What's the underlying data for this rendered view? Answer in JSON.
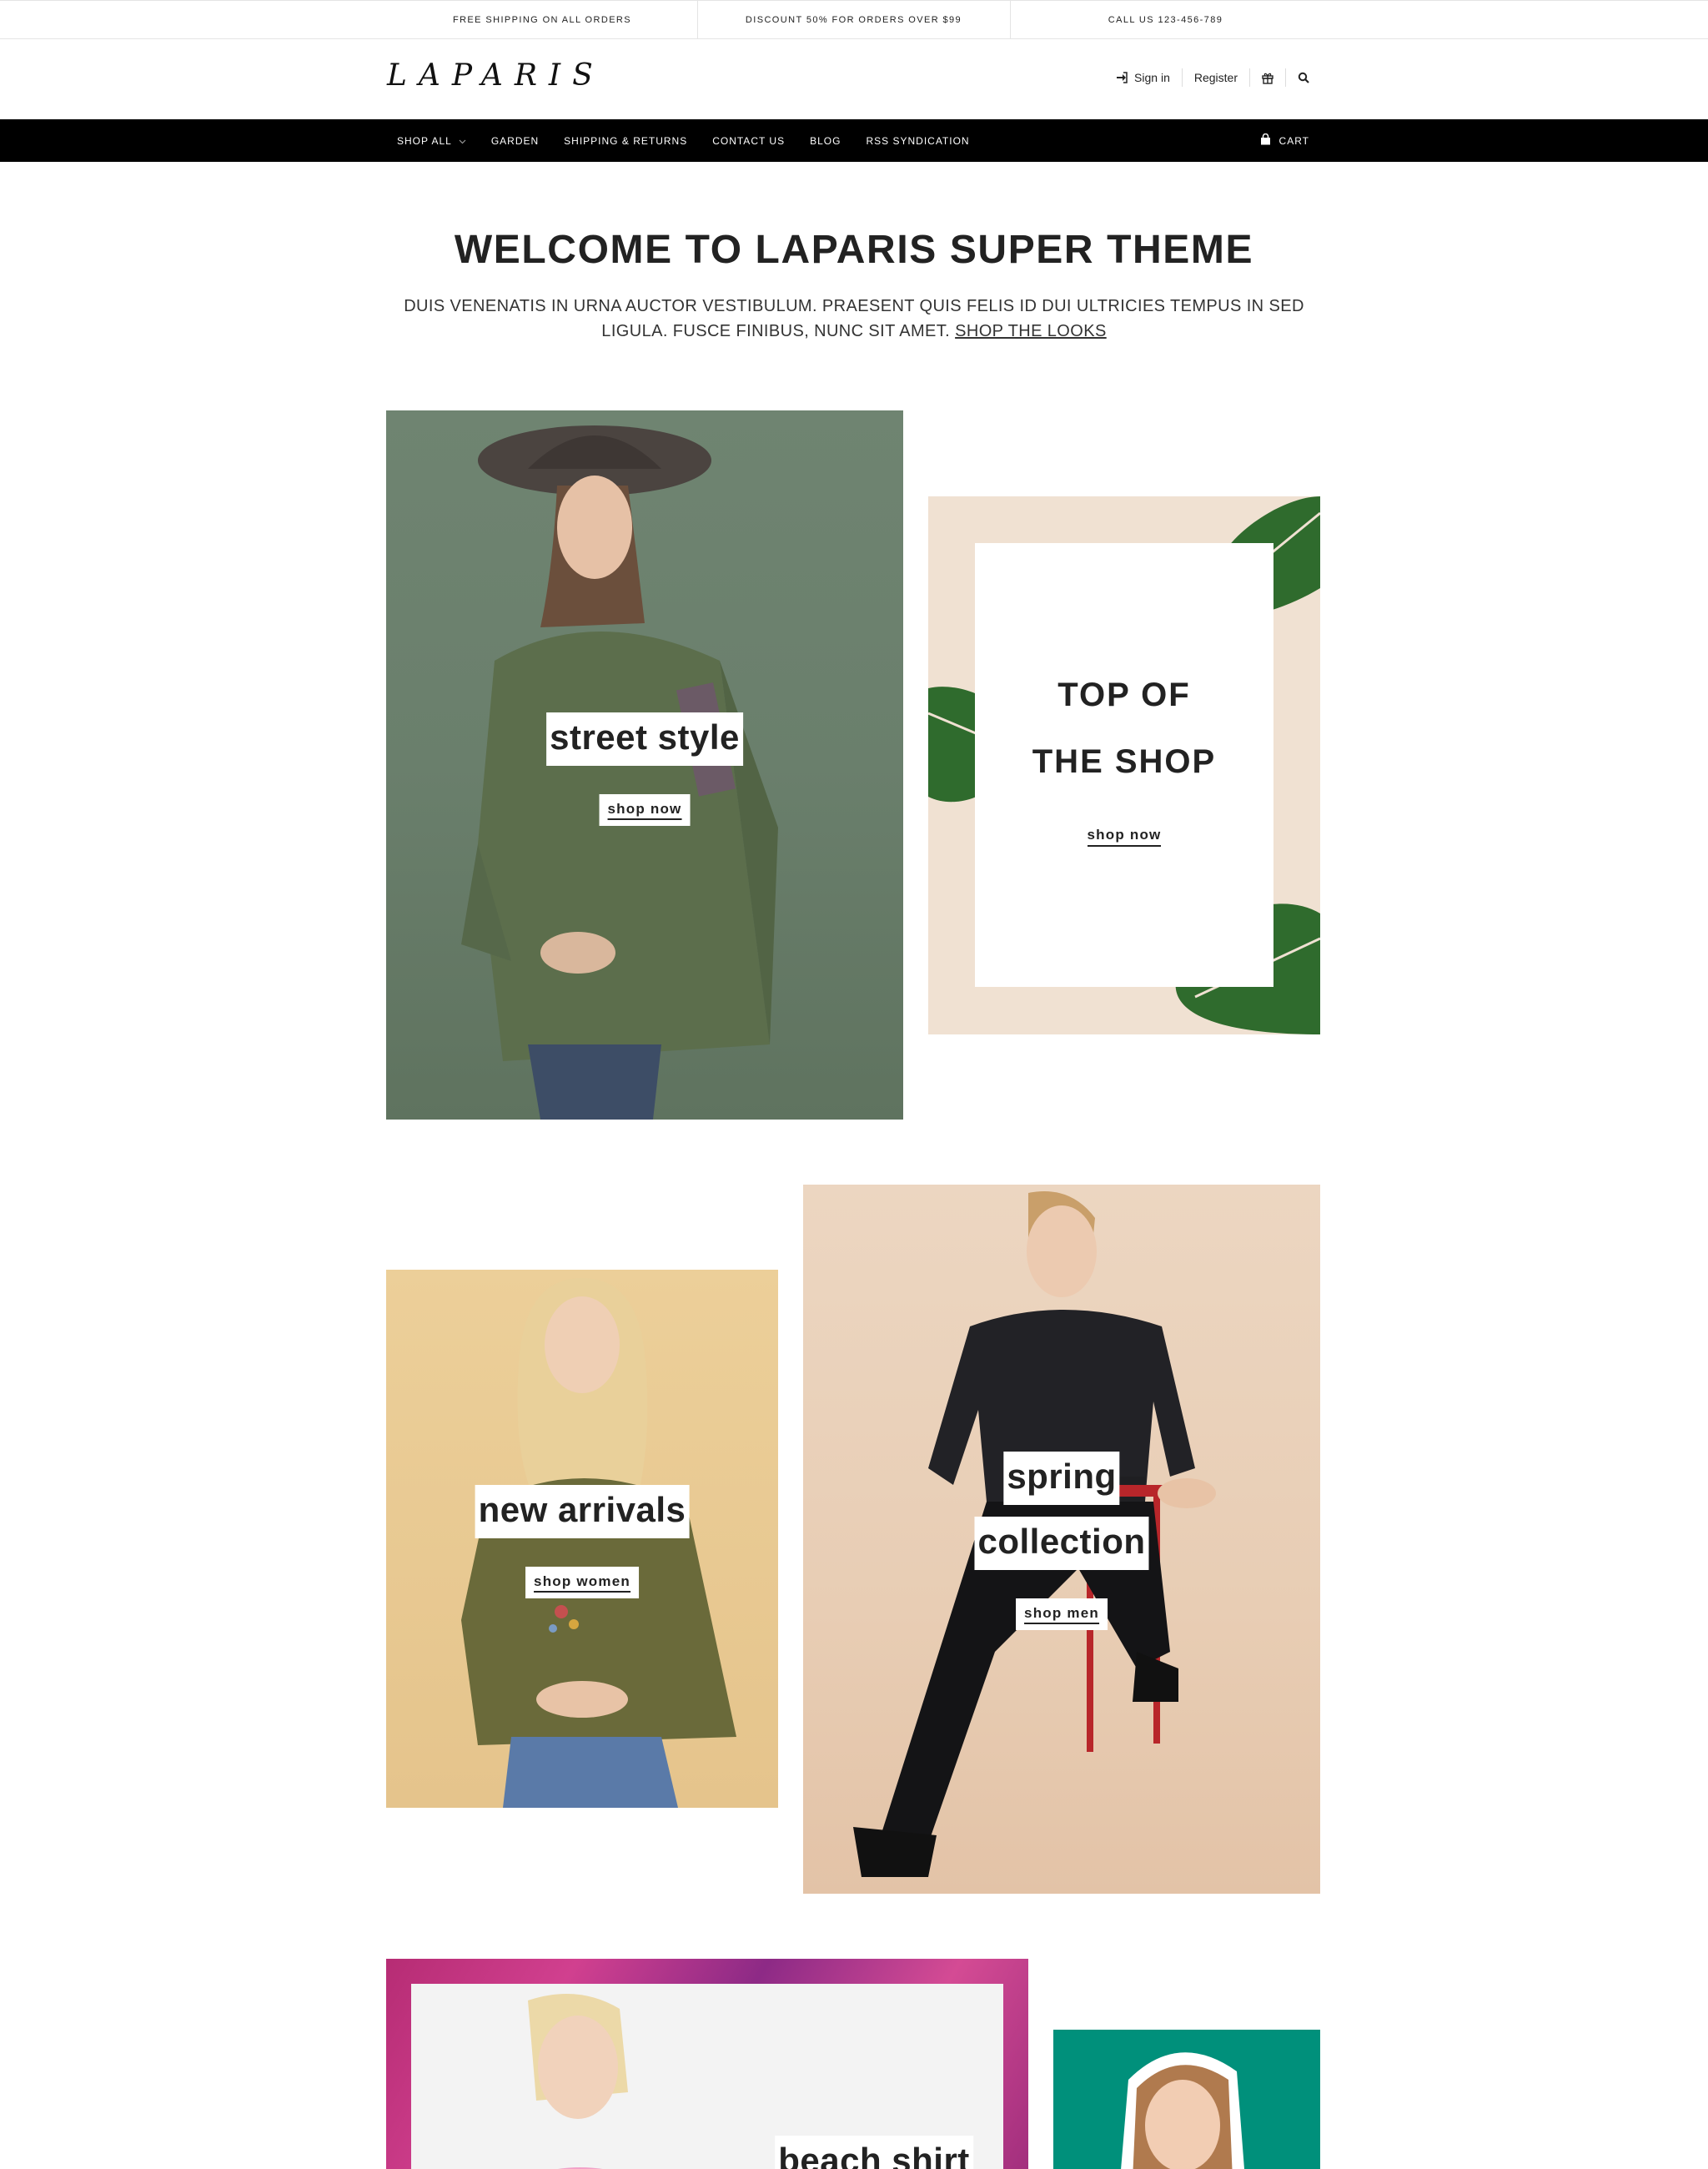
{
  "topbar": {
    "items": [
      "FREE SHIPPING ON ALL ORDERS",
      "DISCOUNT 50% FOR ORDERS OVER $99",
      "CALL US 123-456-789"
    ]
  },
  "header": {
    "logo": "LAPARIS",
    "sign_in": "Sign in",
    "register": "Register",
    "icons": [
      "sign-in-icon",
      "gift-icon",
      "search-icon"
    ]
  },
  "nav": {
    "items": [
      "SHOP ALL",
      "GARDEN",
      "SHIPPING & RETURNS",
      "CONTACT US",
      "BLOG",
      "RSS SYNDICATION"
    ],
    "cart": "CART"
  },
  "intro": {
    "title": "WELCOME TO LAPARIS SUPER THEME",
    "text": "DUIS VENENATIS IN URNA AUCTOR VESTIBULUM. PRAESENT QUIS FELIS ID DUI ULTRICIES TEMPUS IN SED LIGULA. FUSCE FINIBUS, NUNC SIT AMET.",
    "link": "SHOP THE LOOKS"
  },
  "banners": {
    "street": {
      "title": "street style",
      "button": "shop now"
    },
    "top": {
      "title_line1": "TOP OF",
      "title_line2": "THE SHOP",
      "button": "shop now"
    },
    "arrivals": {
      "title": "new arrivals",
      "button": "shop women"
    },
    "spring": {
      "title_line1": "spring",
      "title_line2": "collection",
      "button": "shop men"
    },
    "beach": {
      "title": "beach shirt"
    }
  },
  "colors": {
    "nav_bg": "#000000",
    "top_banner_bg": "#f0e1d2",
    "teal_banner_bg": "#00907b"
  }
}
